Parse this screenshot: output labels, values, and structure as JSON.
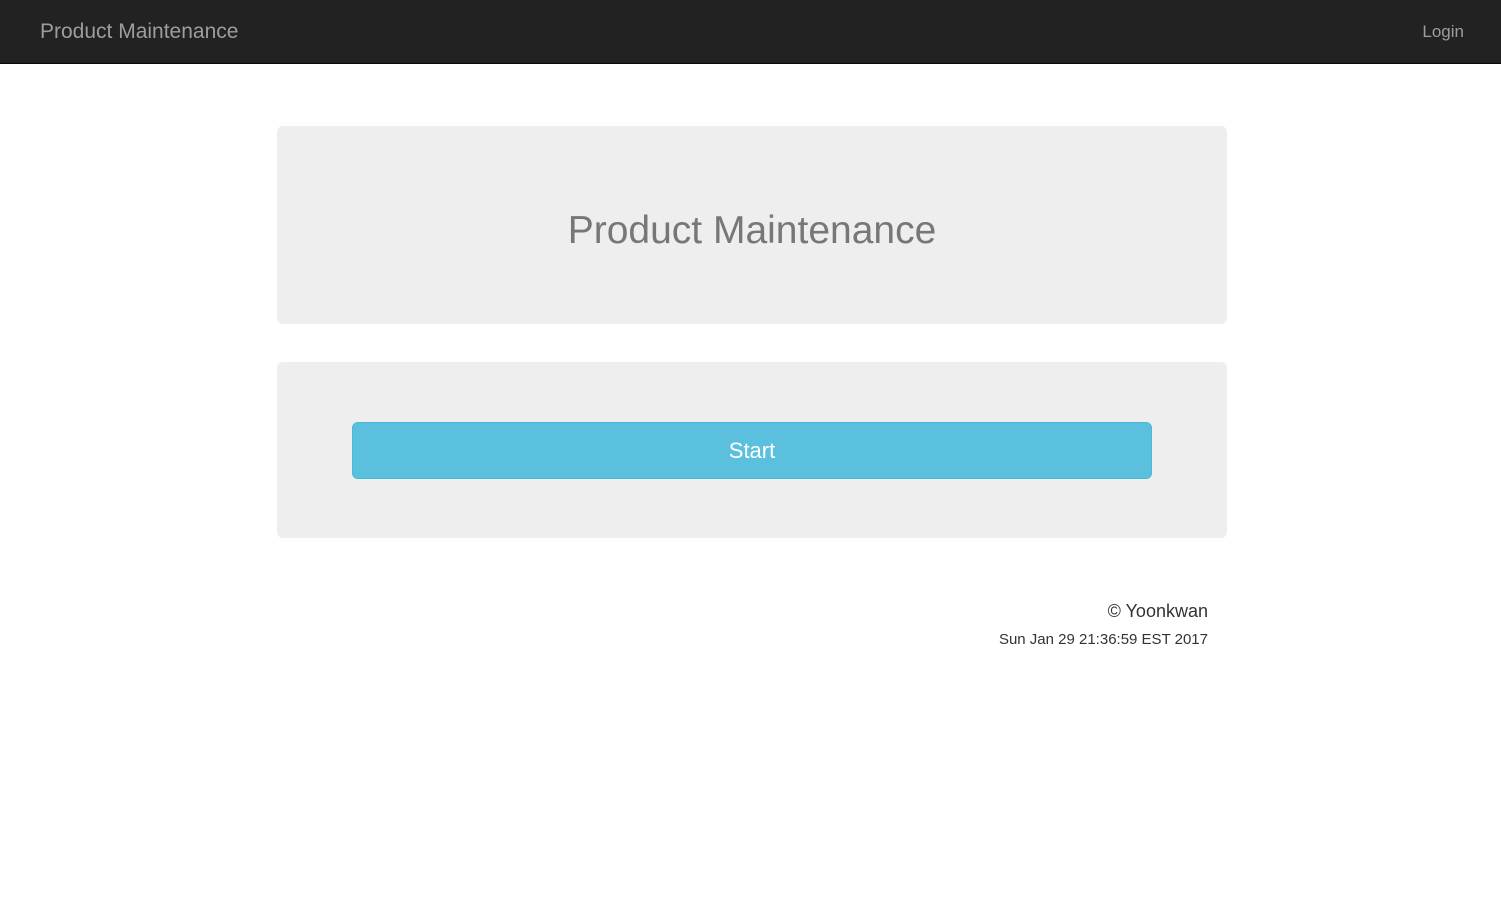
{
  "navbar": {
    "brand": "Product Maintenance",
    "login_label": "Login",
    "background_color": "#222222"
  },
  "main": {
    "title": "Product Maintenance",
    "start_button_label": "Start",
    "button_color": "#5bc0de"
  },
  "footer": {
    "copyright": "© Yoonkwan",
    "timestamp": "Sun Jan 29 21:36:59 EST 2017"
  }
}
